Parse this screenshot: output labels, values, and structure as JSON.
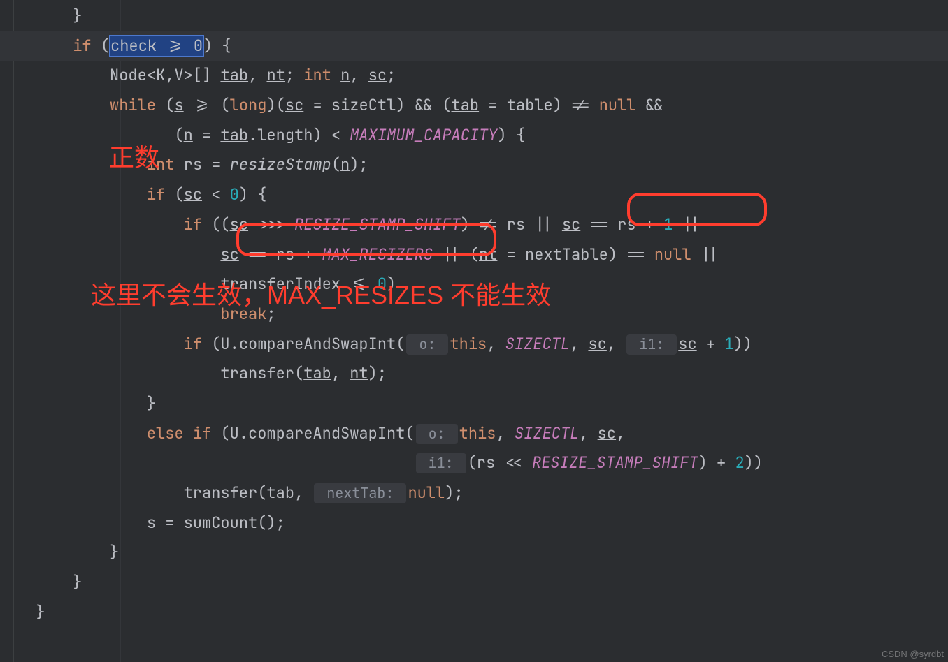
{
  "code": {
    "l1_brace": "      }",
    "l2": {
      "indent": "      ",
      "if": "if",
      "open": " (",
      "cond": "check >= 0",
      "close": ") {"
    },
    "l3": {
      "indent": "          ",
      "node": "Node",
      "gen": "<K,V>[] ",
      "tab": "tab",
      "c1": ", ",
      "nt": "nt",
      "c2": "; ",
      "int": "int",
      "sp": " ",
      "n": "n",
      "c3": ", ",
      "sc": "sc",
      "semi": ";"
    },
    "l4": {
      "indent": "          ",
      "while": "while",
      "open": " (",
      "s": "s",
      "cmp": " >= (",
      "long": "long",
      "mid": ")(",
      "sc": "sc",
      "eq": " = sizeCtl) && (",
      "tab": "tab",
      "eq2": " = table) != ",
      "null": "null",
      "and": " &&"
    },
    "l5": {
      "indent": "                 ",
      "open": "(",
      "n": "n",
      "eq": " = ",
      "tab": "tab",
      "dot": ".length) < ",
      "cap": "MAXIMUM_CAPACITY",
      "close": ") {"
    },
    "l6": {
      "indent": "              ",
      "int": "int",
      "sp": " rs = ",
      "fn": "resizeStamp",
      "open": "(",
      "n": "n",
      "close": ");"
    },
    "l7": {
      "indent": "              ",
      "if": "if",
      "open": " (",
      "sc": "sc",
      "cmp": " < ",
      "zero": "0",
      "close": ") {"
    },
    "l8": {
      "indent": "                  ",
      "if": "if",
      "open": " ((",
      "sc": "sc",
      "shift": " >>> ",
      "rss": "RESIZE_STAMP_SHIFT",
      "mid": ") != rs || ",
      "sc2": "sc",
      "eq": " == rs + ",
      "one": "1",
      "or": " ||"
    },
    "l9": {
      "indent": "                      ",
      "sc": "sc",
      "eq": " == rs + ",
      "mr": "MAX_RESIZERS",
      "or1": " || (",
      "nt": "nt",
      "eq2": " = nextTable) == ",
      "null": "null",
      "or2": " ||"
    },
    "l10": {
      "indent": "                      ",
      "ti": "transferIndex <= ",
      "zero": "0",
      "close": ")"
    },
    "l11": {
      "indent": "                      ",
      "break": "break",
      "semi": ";"
    },
    "l12": {
      "indent": "                  ",
      "if": "if",
      "open": " (U.compareAndSwapInt(",
      "hint1": " o: ",
      "this": "this",
      "c1": ", ",
      "sizectl": "SIZECTL",
      "c2": ", ",
      "sc": "sc",
      "c3": ", ",
      "hint2": " i1: ",
      "sc2": "sc",
      "plus": " + ",
      "one": "1",
      "close": "))"
    },
    "l13": {
      "indent": "                      ",
      "fn": "transfer(",
      "tab": "tab",
      "c": ", ",
      "nt": "nt",
      "close": ");"
    },
    "l14": {
      "indent": "              ",
      "brace": "}"
    },
    "l15": {
      "indent": "              ",
      "else": "else if",
      "open": " (U.compareAndSwapInt(",
      "hint1": " o: ",
      "this": "this",
      "c1": ", ",
      "sizectl": "SIZECTL",
      "c2": ", ",
      "sc": "sc",
      "c3": ","
    },
    "l16": {
      "indent": "                                           ",
      "hint": " i1: ",
      "open": "(rs << ",
      "rss": "RESIZE_STAMP_SHIFT",
      "plus": ") + ",
      "two": "2",
      "close": "))"
    },
    "l17": {
      "indent": "                  ",
      "fn": "transfer(",
      "tab": "tab",
      "c": ", ",
      "hint": " nextTab: ",
      "null": "null",
      "close": ");"
    },
    "l18": {
      "indent": "              ",
      "s": "s",
      "eq": " = sumCount();"
    },
    "l19": {
      "indent": "          ",
      "brace": "}"
    },
    "l20": {
      "indent": "      ",
      "brace": "}"
    },
    "l21": {
      "indent": "  ",
      "brace": "}"
    }
  },
  "annotations": {
    "pos": "正数",
    "note": "这里不会生效，MAX_RESIZES 不能生效"
  },
  "watermark": "CSDN @syrdbt"
}
